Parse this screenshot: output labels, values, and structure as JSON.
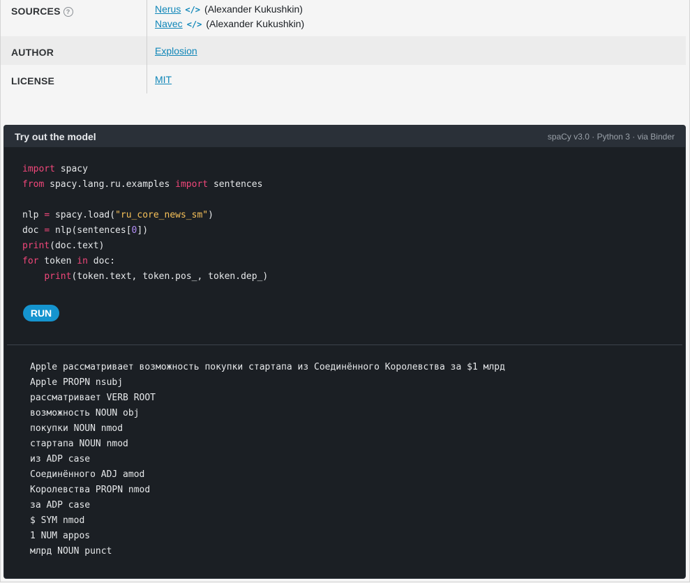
{
  "meta": {
    "sources_label": "SOURCES",
    "help_icon": "question-circle-icon",
    "sources": [
      {
        "name": "Nerus",
        "icon": "code-icon",
        "author": "(Alexander Kukushkin)"
      },
      {
        "name": "Navec",
        "icon": "code-icon",
        "author": "(Alexander Kukushkin)"
      }
    ],
    "author_label": "AUTHOR",
    "author_value": "Explosion",
    "license_label": "LICENSE",
    "license_value": "MIT"
  },
  "widget": {
    "title": "Try out the model",
    "meta": "spaCy v3.0 · Python 3 · via Binder",
    "run_label": "RUN"
  },
  "code_lines": [
    [
      {
        "t": "import",
        "c": "kw"
      },
      {
        "t": " spacy"
      }
    ],
    [
      {
        "t": "from",
        "c": "kw"
      },
      {
        "t": " spacy.lang.ru.examples "
      },
      {
        "t": "import",
        "c": "kw"
      },
      {
        "t": " sentences"
      }
    ],
    [],
    [
      {
        "t": "nlp "
      },
      {
        "t": "=",
        "c": "kw"
      },
      {
        "t": " spacy.load("
      },
      {
        "t": "\"ru_core_news_sm\"",
        "c": "str"
      },
      {
        "t": ")"
      }
    ],
    [
      {
        "t": "doc "
      },
      {
        "t": "=",
        "c": "kw"
      },
      {
        "t": " nlp(sentences["
      },
      {
        "t": "0",
        "c": "num"
      },
      {
        "t": "])"
      }
    ],
    [
      {
        "t": "print",
        "c": "kw"
      },
      {
        "t": "(doc.text)"
      }
    ],
    [
      {
        "t": "for",
        "c": "kw"
      },
      {
        "t": " token "
      },
      {
        "t": "in",
        "c": "kw"
      },
      {
        "t": " doc:"
      }
    ],
    [
      {
        "t": "    "
      },
      {
        "t": "print",
        "c": "kw"
      },
      {
        "t": "(token.text, token.pos_, token.dep_)"
      }
    ]
  ],
  "output_lines": [
    "Apple рассматривает возможность покупки стартапа из Соединённого Королевства за $1 млрд",
    "Apple PROPN nsubj",
    "рассматривает VERB ROOT",
    "возможность NOUN obj",
    "покупки NOUN nmod",
    "стартапа NOUN nmod",
    "из ADP case",
    "Соединённого ADJ amod",
    "Королевства PROPN nmod",
    "за ADP case",
    "$ SYM nmod",
    "1 NUM appos",
    "млрд NOUN punct"
  ]
}
